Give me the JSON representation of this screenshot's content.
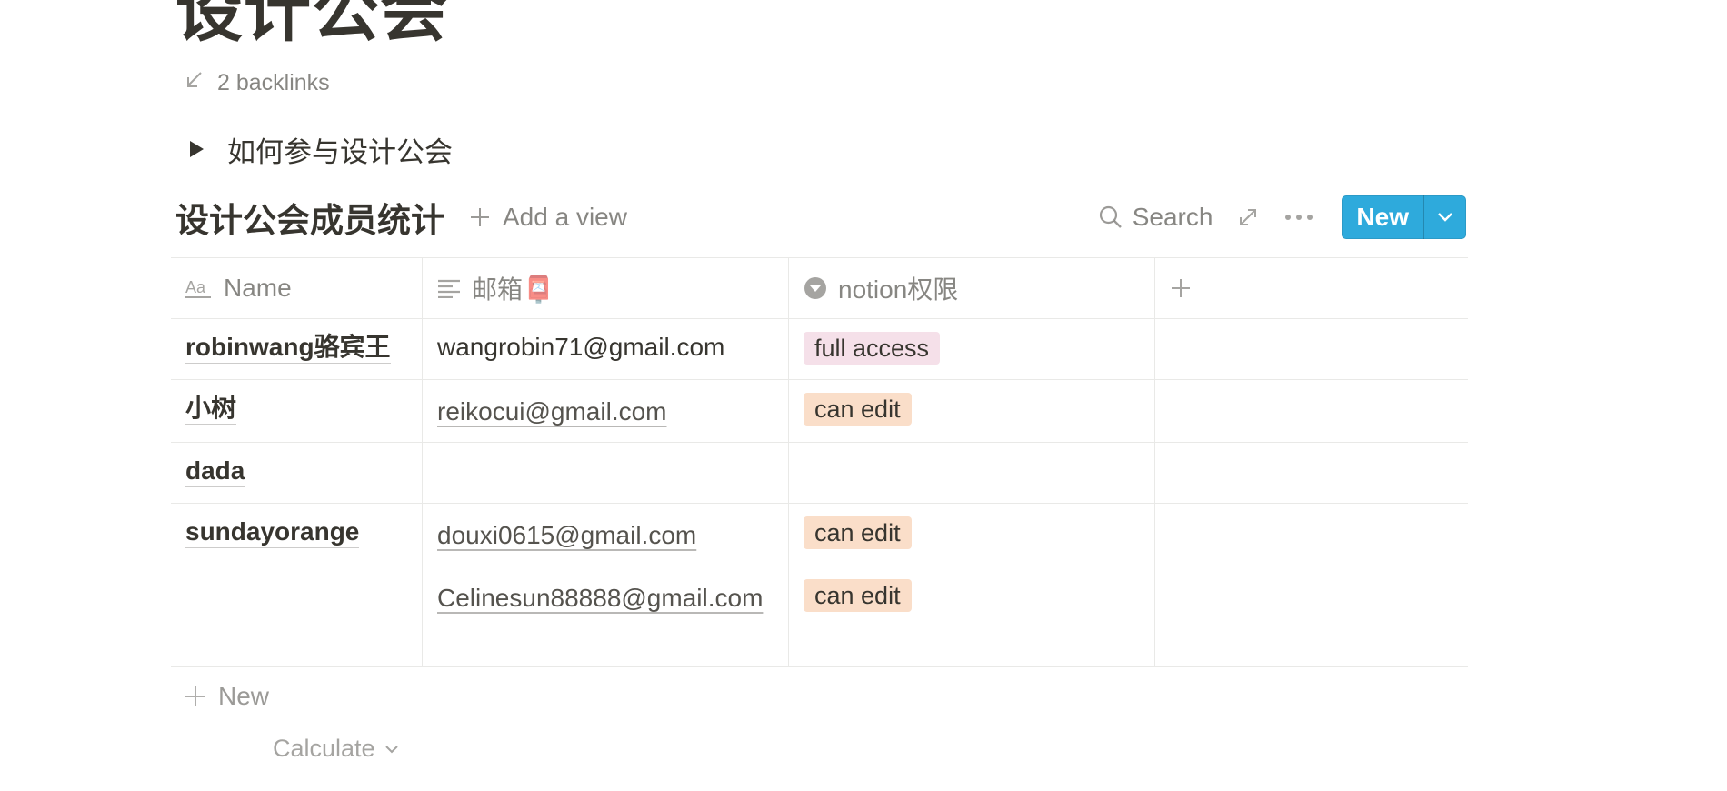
{
  "page": {
    "title": "设计公会",
    "backlinks": "2 backlinks"
  },
  "toggle": {
    "label": "如何参与设计公会"
  },
  "database": {
    "title": "设计公会成员统计",
    "add_view": "Add a view",
    "search": "Search",
    "new_button": "New",
    "columns": [
      {
        "label": "Name",
        "icon": "text-title-icon"
      },
      {
        "label": "邮箱📮",
        "icon": "text-lines-icon"
      },
      {
        "label": "notion权限",
        "icon": "select-icon"
      }
    ],
    "rows": [
      {
        "name": "robinwang骆宾王",
        "email": "wangrobin71@gmail.com",
        "access": "full access"
      },
      {
        "name": "小树",
        "email": "reikocui@gmail.com",
        "access": "can edit"
      },
      {
        "name": "dada",
        "email": "",
        "access": ""
      },
      {
        "name": "sundayorange",
        "email": "douxi0615@gmail.com",
        "access": "can edit"
      },
      {
        "name": "",
        "email": "Celinesun88888@gmail.com",
        "access": "can edit"
      }
    ],
    "new_row": "New",
    "calculate": "Calculate"
  },
  "colors": {
    "accent": "#2eaadc",
    "tag_full_access": "#f5e0e9",
    "tag_can_edit": "#fadec9",
    "text": "#37352f"
  }
}
